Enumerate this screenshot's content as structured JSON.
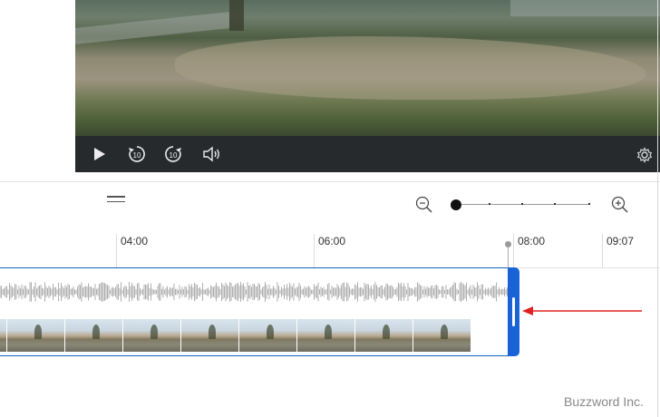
{
  "video_controls": {
    "play": "play-icon",
    "skip_back": "10",
    "skip_forward": "10",
    "volume": "volume-icon",
    "settings": "gear-icon"
  },
  "timeline": {
    "menu_icon": "hamburger-icon",
    "zoom_out_icon": "zoom-out-icon",
    "zoom_in_icon": "zoom-in-icon",
    "zoom_level_fraction": 0.0,
    "ruler_labels": [
      "04:00",
      "06:00",
      "08:00",
      "09:07"
    ],
    "trim_handle_color": "#1a63d6",
    "clip_border_color": "#1565c0"
  },
  "annotation": {
    "arrow_color": "#e02020"
  },
  "credit": "Buzzword Inc."
}
